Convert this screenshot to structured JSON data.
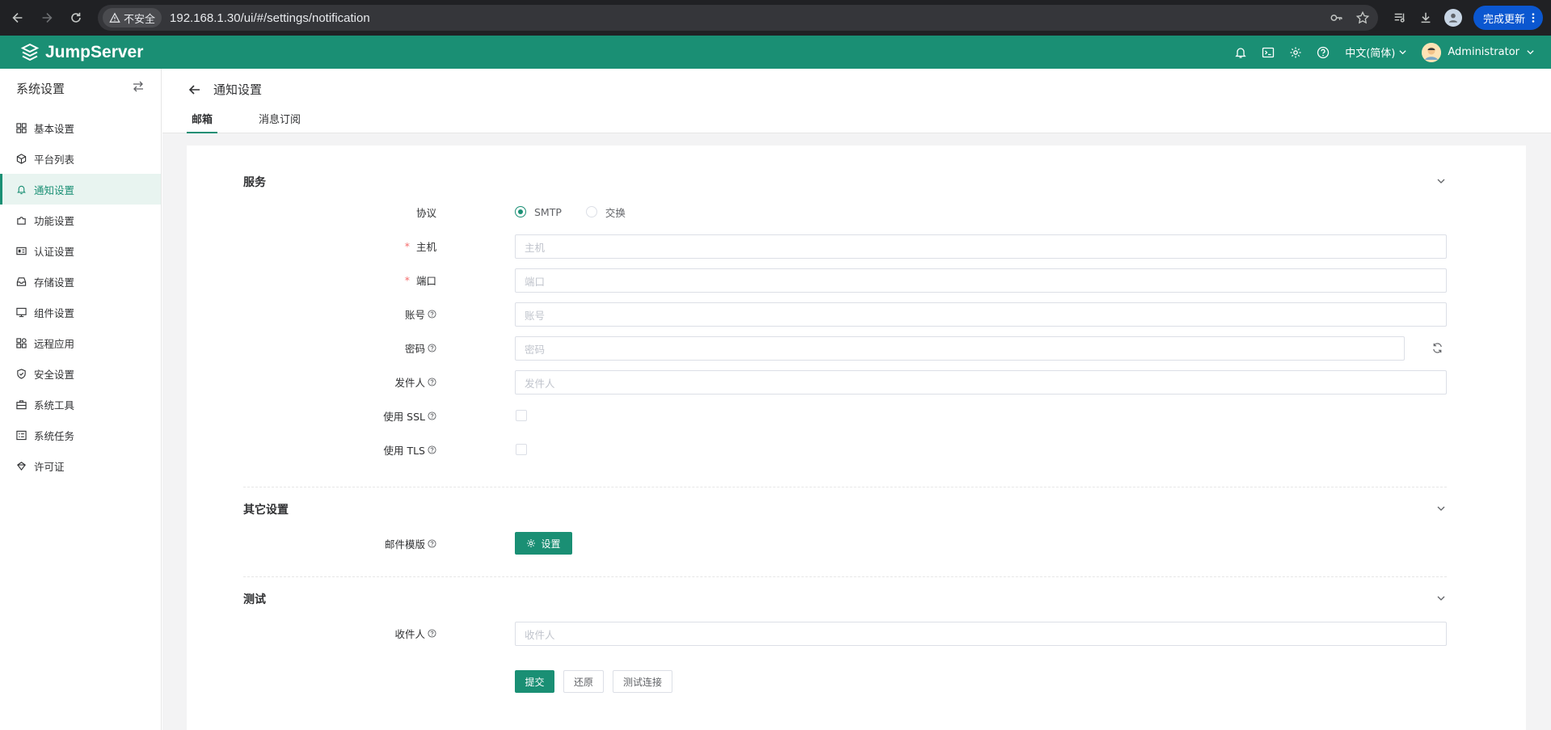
{
  "browser": {
    "security_label": "不安全",
    "url": "192.168.1.30/ui/#/settings/notification",
    "update_label": "完成更新"
  },
  "header": {
    "brand": "JumpServer",
    "language": "中文(简体)",
    "user": "Administrator"
  },
  "sidebar": {
    "title": "系统设置",
    "items": [
      {
        "label": "基本设置",
        "icon": "grid-icon"
      },
      {
        "label": "平台列表",
        "icon": "cube-icon"
      },
      {
        "label": "通知设置",
        "icon": "bell-icon",
        "active": true
      },
      {
        "label": "功能设置",
        "icon": "puzzle-icon"
      },
      {
        "label": "认证设置",
        "icon": "id-card-icon"
      },
      {
        "label": "存储设置",
        "icon": "inbox-icon"
      },
      {
        "label": "组件设置",
        "icon": "monitor-icon"
      },
      {
        "label": "远程应用",
        "icon": "apps-icon"
      },
      {
        "label": "安全设置",
        "icon": "shield-icon"
      },
      {
        "label": "系统工具",
        "icon": "toolbox-icon"
      },
      {
        "label": "系统任务",
        "icon": "tasks-icon"
      },
      {
        "label": "许可证",
        "icon": "license-icon"
      }
    ]
  },
  "page": {
    "title": "通知设置",
    "tabs": [
      {
        "label": "邮箱",
        "active": true
      },
      {
        "label": "消息订阅",
        "active": false
      }
    ]
  },
  "form": {
    "service": {
      "title": "服务",
      "protocol_label": "协议",
      "protocol_options": [
        "SMTP",
        "交换"
      ],
      "host_label": "主机",
      "host_placeholder": "主机",
      "port_label": "端口",
      "port_placeholder": "端口",
      "account_label": "账号",
      "account_placeholder": "账号",
      "password_label": "密码",
      "password_placeholder": "密码",
      "sender_label": "发件人",
      "sender_placeholder": "发件人",
      "ssl_label": "使用 SSL",
      "tls_label": "使用 TLS"
    },
    "other": {
      "title": "其它设置",
      "template_label": "邮件模版",
      "settings_button": "设置"
    },
    "test": {
      "title": "测试",
      "recipient_label": "收件人",
      "recipient_placeholder": "收件人"
    },
    "actions": {
      "submit": "提交",
      "reset": "还原",
      "test_connection": "测试连接"
    }
  },
  "colors": {
    "brand": "#1a8f74",
    "required": "#f56c6c"
  }
}
